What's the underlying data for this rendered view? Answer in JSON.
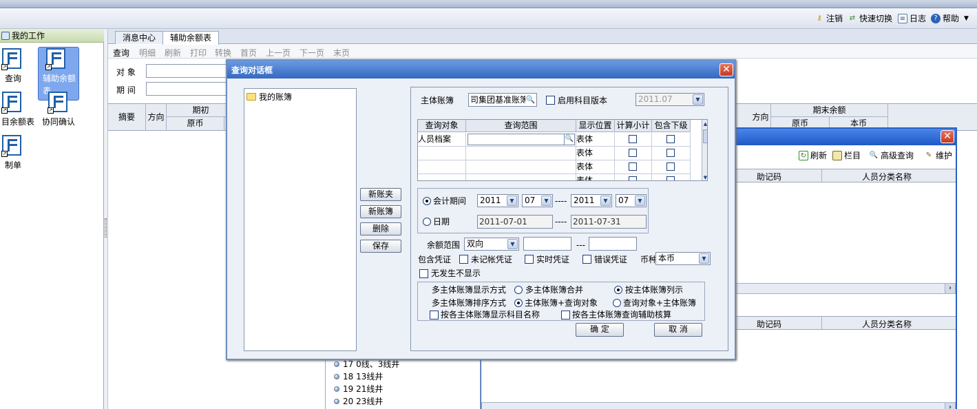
{
  "top_toolbar": {
    "items": [
      {
        "icon": "key-icon",
        "label": "注销"
      },
      {
        "icon": "switch-icon",
        "label": "快速切换"
      },
      {
        "icon": "log-icon",
        "label": "日志"
      },
      {
        "icon": "help-icon",
        "label": "帮助"
      }
    ]
  },
  "left_pane": {
    "title": "我的工作",
    "items": [
      {
        "label": "查询"
      },
      {
        "label": "辅助余额表"
      },
      {
        "label": "目余额表"
      },
      {
        "label": "协同确认"
      },
      {
        "label": "制单"
      }
    ]
  },
  "main": {
    "tabs": [
      {
        "label": "消息中心"
      },
      {
        "label": "辅助余额表"
      }
    ],
    "toolbar": [
      "查询",
      "明细",
      "刷新",
      "打印",
      "转换",
      "首页",
      "上一页",
      "下一页",
      "末页"
    ],
    "filter_labels": {
      "object": "对 象",
      "period": "期 间"
    },
    "grid_headers": {
      "summary": "摘要",
      "direction": "方向",
      "opening": "期初",
      "orig_currency": "原币",
      "direction2": "方向",
      "closing": "期末余额",
      "orig_currency2": "原币",
      "local_currency": "本币"
    }
  },
  "back_dialog": {
    "toolbar": [
      {
        "icon": "refresh-icon",
        "label": "刷新"
      },
      {
        "icon": "columns-icon",
        "label": "栏目"
      },
      {
        "icon": "advanced-search-icon",
        "label": "高级查询"
      },
      {
        "icon": "maintain-icon",
        "label": "维护"
      }
    ],
    "headers": {
      "mnemonic": "助记码",
      "category": "人员分类名称"
    }
  },
  "tree_items": [
    "17 0线、3线井",
    "18 13线井",
    "19 21线井",
    "20 23线井"
  ],
  "dialog": {
    "title": "查询对话框",
    "tree_root": "我的账簿",
    "buttons": {
      "new_folder": "新账夹",
      "new_book": "新账簿",
      "delete": "删除",
      "save": "保存",
      "ok": "确 定",
      "cancel": "取 消"
    },
    "main_book_label": "主体账簿",
    "main_book_value": "司集团基准账簿",
    "enable_version_label": "启用科目版本",
    "version_value": "2011.07",
    "query_table": {
      "headers": [
        "查询对象",
        "查询范围",
        "显示位置",
        "计算小计",
        "包含下级"
      ],
      "rows": [
        {
          "object": "人员档案",
          "position": "表体"
        },
        {
          "object": "",
          "position": "表体"
        },
        {
          "object": "",
          "position": "表体"
        },
        {
          "object": "",
          "position": "表体"
        }
      ]
    },
    "period": {
      "accounting_label": "会计期间",
      "from_year": "2011",
      "from_month": "07",
      "to_year": "2011",
      "to_month": "07",
      "date_label": "日期",
      "from_date": "2011-07-01",
      "to_date": "2011-07-31",
      "sep": "----"
    },
    "balance_range_label": "余额范围",
    "balance_range_value": "双向",
    "range_sep": "---",
    "include_voucher_label": "包含凭证",
    "unposted_label": "未记帐凭证",
    "realtime_label": "实时凭证",
    "error_label": "错误凭证",
    "currency_label": "币种",
    "currency_value": "本币",
    "no_occurrence_label": "无发生不显示",
    "multi_display_label": "多主体账簿显示方式",
    "multi_merge_label": "多主体账簿合并",
    "multi_list_label": "按主体账簿列示",
    "multi_sort_label": "多主体账簿排序方式",
    "sort_a_label": "主体账簿+查询对象",
    "sort_b_label": "查询对象+主体账簿",
    "show_subject_label": "按各主体账簿显示科目名称",
    "query_aux_label": "按各主体账簿查询辅助核算"
  }
}
